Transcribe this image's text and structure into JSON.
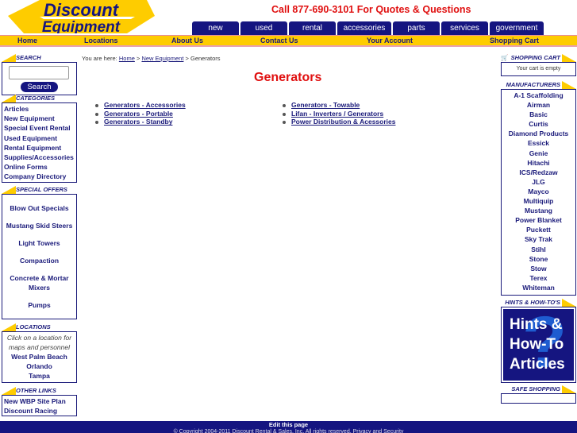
{
  "header": {
    "logo_line1": "Discount",
    "logo_line2": "Equipment",
    "phone": "Call 877-690-3101 For Quotes & Questions",
    "tabs": [
      {
        "label": "new"
      },
      {
        "label": "used"
      },
      {
        "label": "rental"
      },
      {
        "label": "accessories"
      },
      {
        "label": "parts"
      },
      {
        "label": "services"
      },
      {
        "label": "government"
      }
    ]
  },
  "nav": {
    "items": [
      {
        "label": "Home"
      },
      {
        "label": "Locations"
      },
      {
        "label": "About Us"
      },
      {
        "label": "Contact Us"
      },
      {
        "label": "Your Account"
      },
      {
        "label": "Shopping Cart"
      }
    ]
  },
  "search": {
    "heading": "SEARCH",
    "input_value": "",
    "button_label": "Search"
  },
  "categories": {
    "heading": "CATEGORIES",
    "items": [
      "Articles",
      "New Equipment",
      "Special Event Rental",
      "Used Equipment",
      "Rental Equipment",
      "Supplies/Accessories",
      "Online Forms",
      "Company Directory"
    ]
  },
  "special_offers": {
    "heading": "SPECIAL OFFERS",
    "items": [
      "Blow Out Specials",
      "Mustang Skid Steers",
      "Light Towers",
      "Compaction",
      "Concrete & Mortar Mixers",
      "Pumps"
    ]
  },
  "locations": {
    "heading": "LOCATIONS",
    "note": "Click on a location for maps and personnel",
    "items": [
      "West Palm Beach",
      "Orlando",
      "Tampa"
    ]
  },
  "other_links": {
    "heading": "OTHER LINKS",
    "items": [
      "New WBP Site Plan",
      "Discount Racing"
    ]
  },
  "breadcrumb": {
    "prefix": "You are here:",
    "items": [
      "Home",
      "New Equipment"
    ],
    "separator": ">",
    "current": "Generators"
  },
  "main": {
    "title": "Generators",
    "left_links": [
      "Generators - Accessories",
      "Generators - Portable",
      "Generators - Standby"
    ],
    "right_links": [
      "Generators - Towable",
      "Lifan - Inverters / Generators",
      "Power Distribution & Acessories"
    ]
  },
  "cart": {
    "heading": "SHOPPING CART",
    "status": "Your cart is empty"
  },
  "manufacturers": {
    "heading": "MANUFACTURERS",
    "items": [
      "A-1 Scaffolding",
      "Airman",
      "Basic",
      "Curtis",
      "Diamond Products",
      "Essick",
      "Genie",
      "Hitachi",
      "ICS/Redzaw",
      "JLG",
      "Mayco",
      "Multiquip",
      "Mustang",
      "Power Blanket",
      "Puckett",
      "Sky Trak",
      "Stihl",
      "Stone",
      "Stow",
      "Terex",
      "Whiteman"
    ]
  },
  "hints": {
    "heading": "HINTS & HOW-TO'S",
    "banner_line1": "Hints &",
    "banner_line2": "How-To",
    "banner_line3": "Articles"
  },
  "safe_shopping": {
    "heading": "SAFE SHOPPING"
  },
  "footer": {
    "edit_label": "Edit this page",
    "copyright": "© Copyright 2004-2011 Discount Rental & Sales, Inc. All rights reserved. Privacy and Security"
  },
  "colors": {
    "navy": "#151580",
    "gold": "#fecc00",
    "red": "#e01010",
    "link": "#1a1a7a"
  }
}
